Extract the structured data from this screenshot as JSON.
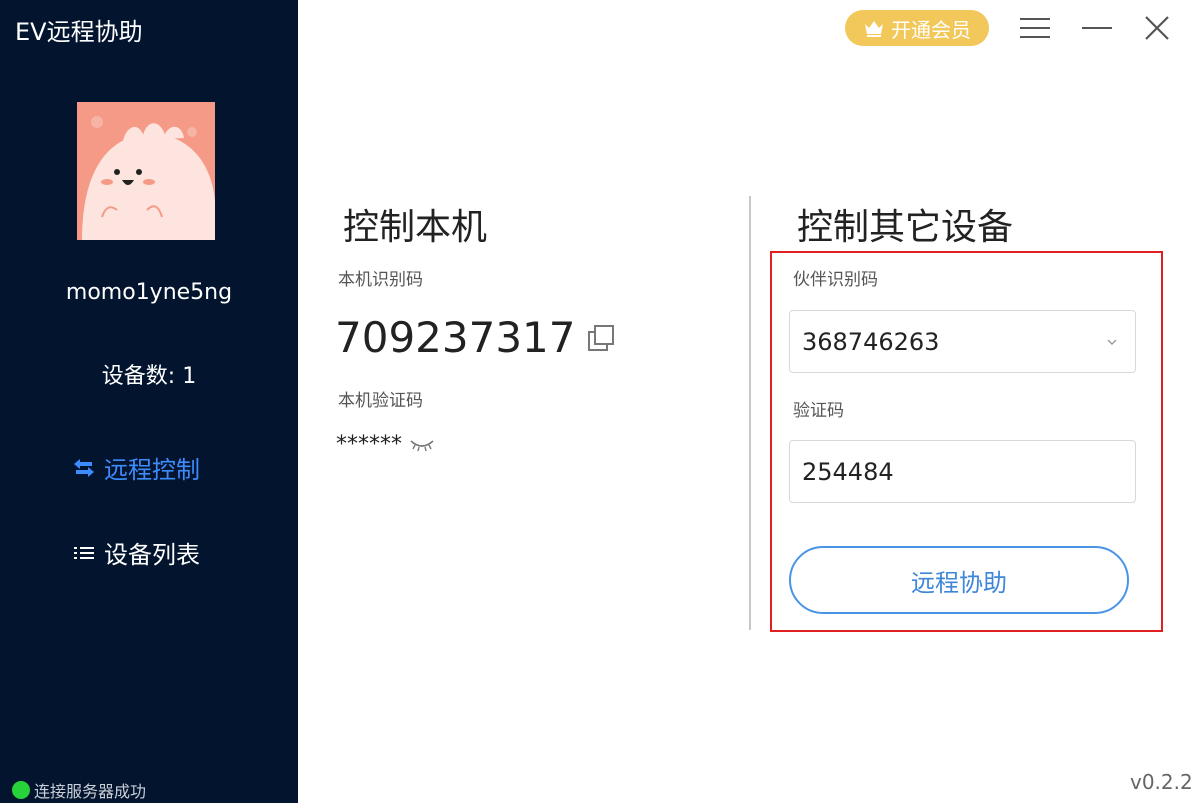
{
  "app": {
    "title": "EV远程协助"
  },
  "sidebar": {
    "username": "momo1yne5ng",
    "device_count": "设备数: 1",
    "nav": [
      {
        "label": "远程控制",
        "icon": "swap-arrows-icon",
        "active": true
      },
      {
        "label": "设备列表",
        "icon": "list-icon",
        "active": false
      }
    ],
    "status": "连接服务器成功",
    "status_color": "#27d23b",
    "background": "#02142e"
  },
  "topbar": {
    "vip_label": "开通会员",
    "vip_color": "#f2c85a"
  },
  "local": {
    "title": "控制本机",
    "id_label": "本机识别码",
    "id_value": "709237317",
    "pwd_label": "本机验证码",
    "pwd_value": "******"
  },
  "remote": {
    "title": "控制其它设备",
    "partner_label": "伙伴识别码",
    "partner_value": "368746263",
    "code_label": "验证码",
    "code_value": "254484",
    "button_label": "远程协助",
    "accent_color": "#4a94e6"
  },
  "version": "v0.2.2"
}
